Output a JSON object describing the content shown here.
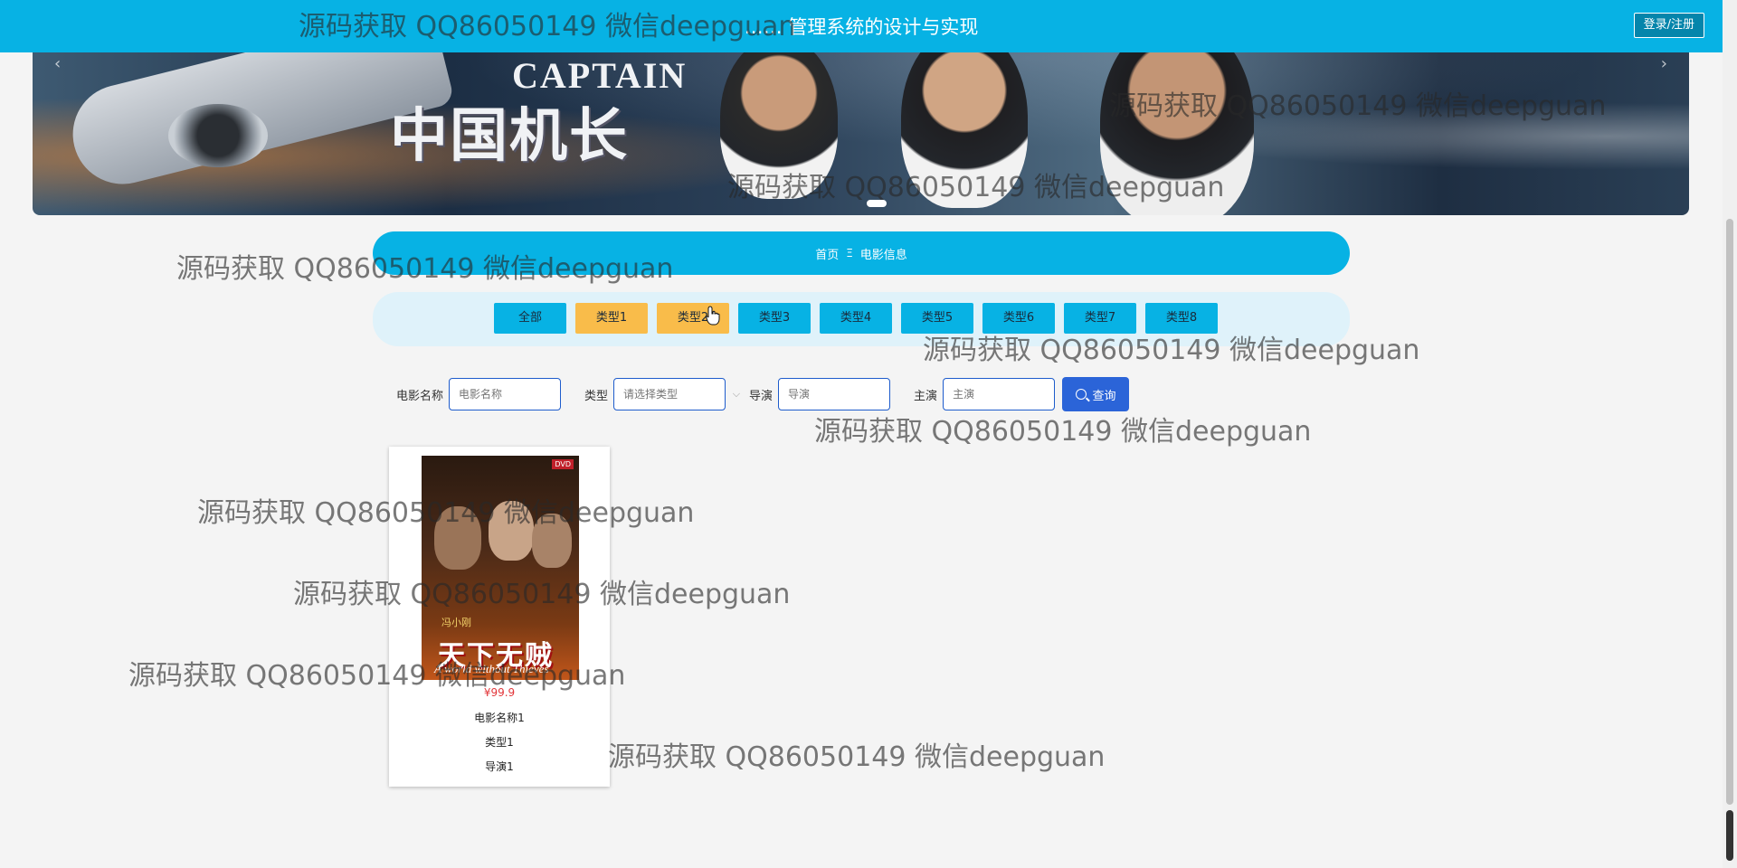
{
  "header": {
    "title": "…… 管理系统的设计与实现",
    "login_label": "登录/注册"
  },
  "banner": {
    "movie_en": "CAPTAIN",
    "movie_cn": "中国机长"
  },
  "breadcrumb": {
    "home": "首页",
    "separator": "Ξ",
    "current": "电影信息"
  },
  "categories": [
    "全部",
    "类型1",
    "类型2",
    "类型3",
    "类型4",
    "类型5",
    "类型6",
    "类型7",
    "类型8"
  ],
  "search": {
    "name_label": "电影名称",
    "name_placeholder": "电影名称",
    "type_label": "类型",
    "type_placeholder": "请选择类型",
    "director_label": "导演",
    "director_placeholder": "导演",
    "actor_label": "主演",
    "actor_placeholder": "主演",
    "query_label": "查询"
  },
  "movies": [
    {
      "poster_title_cn": "天下无贼",
      "poster_title_en": "A world without Thieves",
      "poster_sub": "冯小刚",
      "poster_badge": "DVD",
      "price": "¥99.9",
      "name": "电影名称1",
      "type": "类型1",
      "director": "导演1"
    }
  ],
  "watermark": "源码获取 QQ86050149 微信deepguan",
  "colors": {
    "primary": "#07b2e4",
    "accent_orange": "#f9bc4a",
    "query_button": "#2b64d8",
    "price": "#e2363a"
  }
}
